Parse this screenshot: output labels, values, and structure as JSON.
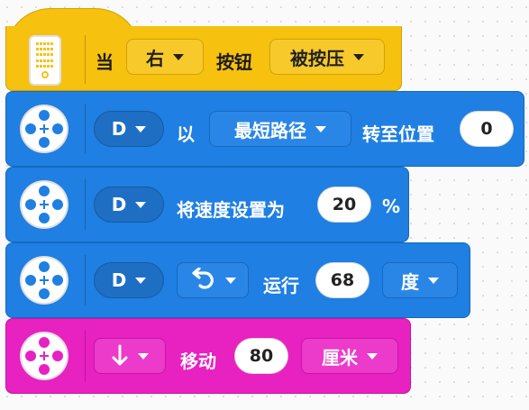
{
  "hat_block": {
    "when": "当",
    "button_selector": "右",
    "button_word": "按钮",
    "event_selector": "被按压",
    "color": "#f6c10f"
  },
  "motor_go_to": {
    "port": "D",
    "with": "以",
    "direction": "最短路径",
    "suffix": "转至位置",
    "position": "0",
    "color": "#1f7fe2"
  },
  "motor_speed": {
    "port": "D",
    "label": "将速度设置为",
    "speed": "20",
    "unit": "%"
  },
  "motor_run": {
    "port": "D",
    "direction_icon": "counterclockwise-arrow-icon",
    "label": "运行",
    "amount": "68",
    "unit_selector": "度"
  },
  "move_block": {
    "direction_icon": "down-arrow-icon",
    "label": "移动",
    "distance": "80",
    "unit_selector": "厘米",
    "color": "#e821c1"
  }
}
